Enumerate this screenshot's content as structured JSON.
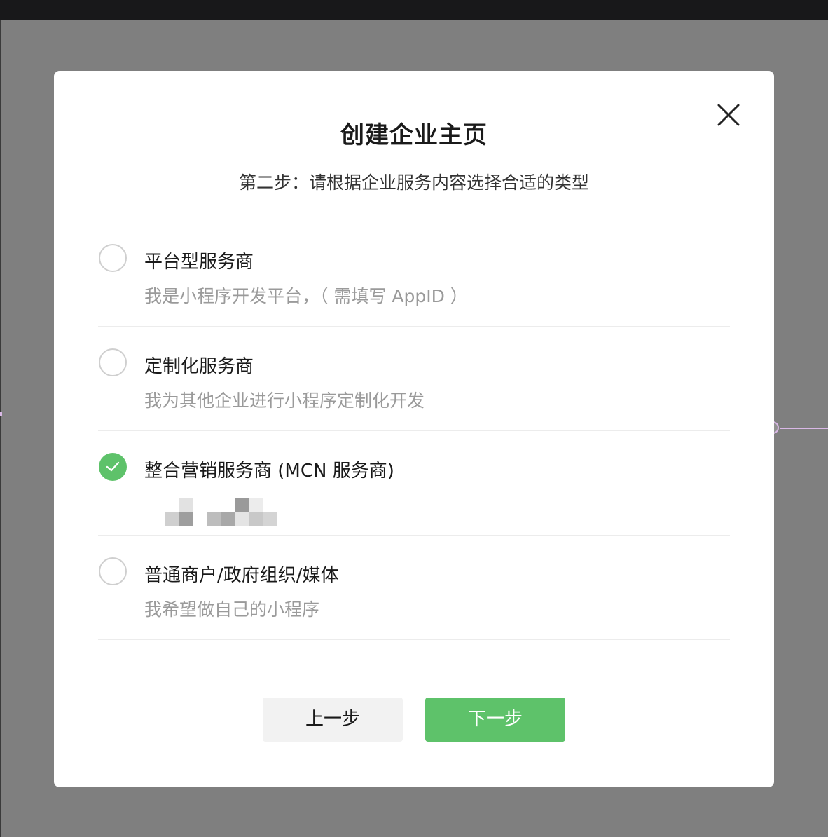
{
  "modal": {
    "title": "创建企业主页",
    "subtitle": "第二步：请根据企业服务内容选择合适的类型",
    "close_icon": "close-icon",
    "options": [
      {
        "title": "平台型服务商",
        "description": "我是小程序开发平台，（ 需填写 AppID ）",
        "selected": false
      },
      {
        "title": "定制化服务商",
        "description": "我为其他企业进行小程序定制化开发",
        "selected": false
      },
      {
        "title": "整合营销服务商 (MCN 服务商)",
        "description": "",
        "description_redacted": true,
        "selected": true
      },
      {
        "title": "普通商户/政府组织/媒体",
        "description": "我希望做自己的小程序",
        "selected": false
      }
    ],
    "buttons": {
      "prev_label": "上一步",
      "next_label": "下一步"
    }
  },
  "colors": {
    "accent": "#5ec26a",
    "overlay": "#7f7f7f",
    "topbar": "#18181a",
    "guide": "#d9b8e6"
  }
}
